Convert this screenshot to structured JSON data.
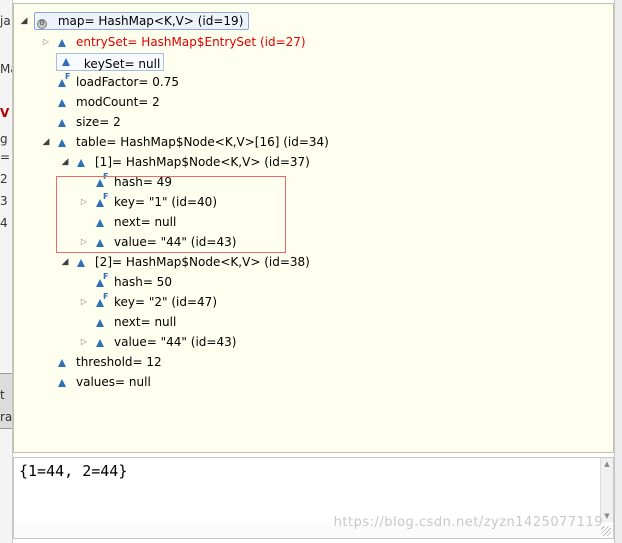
{
  "background_fragments": [
    "ja",
    "Ma",
    "V",
    "g",
    "=",
    "2",
    "3",
    "4",
    "t",
    "ra"
  ],
  "tree": {
    "root": {
      "label": "map= HashMap<K,V>  (id=19)",
      "root_icon": "circle-gear-icon"
    },
    "rows": [
      {
        "label": "entrySet= HashMap$EntrySet  (id=27)",
        "red": true,
        "has_children": true,
        "final": false
      },
      {
        "label": "keySet= null",
        "red": false,
        "has_children": false,
        "final": false
      },
      {
        "label": "loadFactor= 0.75",
        "red": false,
        "has_children": false,
        "final": true
      },
      {
        "label": "modCount= 2",
        "red": false,
        "has_children": false,
        "final": false
      },
      {
        "label": "size= 2",
        "red": false,
        "has_children": false,
        "final": false
      },
      {
        "label": "table= HashMap$Node<K,V>[16]  (id=34)",
        "red": false,
        "has_children": true,
        "expanded": true,
        "final": false
      },
      {
        "label": "[1]= HashMap$Node<K,V>  (id=37)",
        "red": false,
        "has_children": true,
        "expanded": true,
        "final": false
      },
      {
        "label": "hash= 49",
        "red": false,
        "has_children": false,
        "final": true
      },
      {
        "label": "key= \"1\" (id=40)",
        "red": false,
        "has_children": true,
        "final": true
      },
      {
        "label": "next= null",
        "red": false,
        "has_children": false,
        "final": false
      },
      {
        "label": "value= \"44\" (id=43)",
        "red": false,
        "has_children": true,
        "final": false
      },
      {
        "label": "[2]= HashMap$Node<K,V>  (id=38)",
        "red": false,
        "has_children": true,
        "expanded": true,
        "final": false
      },
      {
        "label": "hash= 50",
        "red": false,
        "has_children": false,
        "final": true
      },
      {
        "label": "key= \"2\" (id=47)",
        "red": false,
        "has_children": true,
        "final": true
      },
      {
        "label": "next= null",
        "red": false,
        "has_children": false,
        "final": false
      },
      {
        "label": "value= \"44\" (id=43)",
        "red": false,
        "has_children": true,
        "final": false
      },
      {
        "label": "threshold= 12",
        "red": false,
        "has_children": false,
        "final": false
      },
      {
        "label": "values= null",
        "red": false,
        "has_children": false,
        "final": false
      }
    ]
  },
  "detail": {
    "text": "{1=44, 2=44}"
  },
  "watermark": "https://blog.csdn.net/zyzn1425077119",
  "colors": {
    "field_icon": "#2f6fb7",
    "highlight": "#e86a6a",
    "tree_bg": "#fffff0",
    "red_label": "#e00000"
  }
}
